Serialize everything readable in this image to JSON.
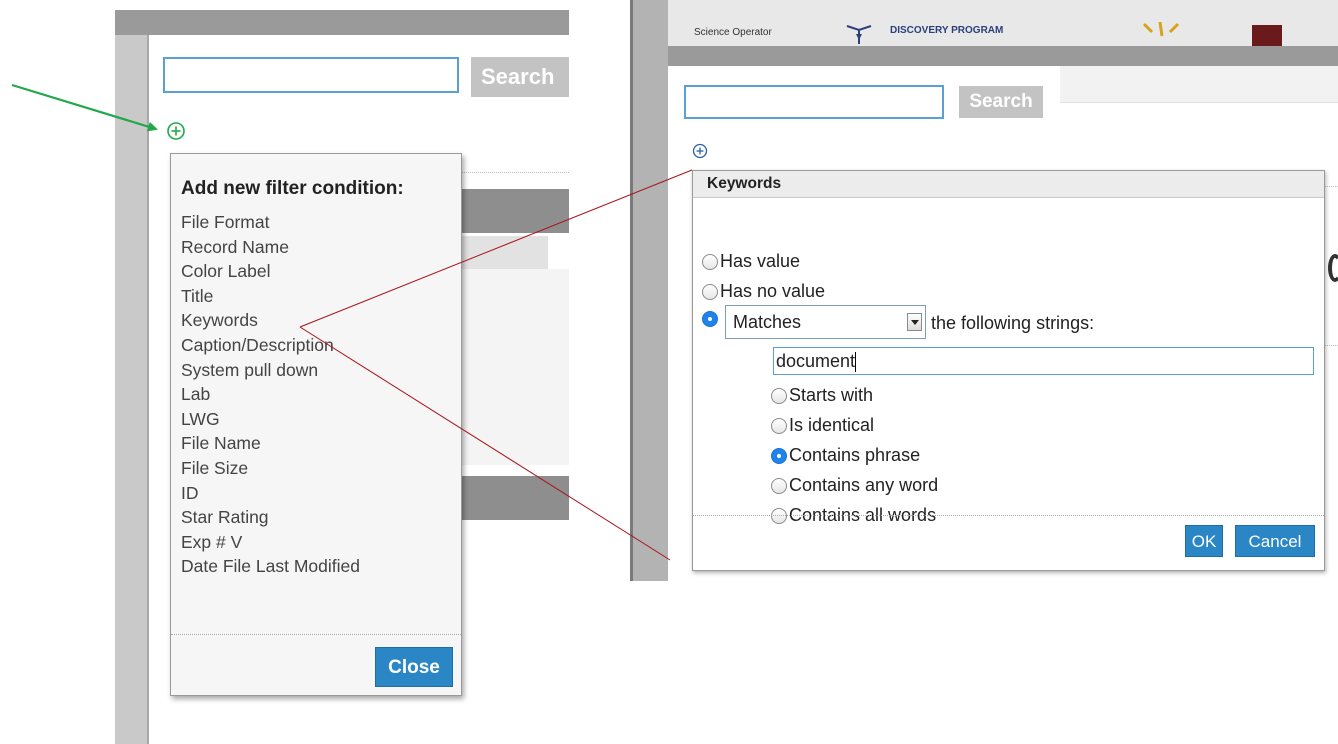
{
  "left_panel": {
    "search_button": "Search",
    "add_filter_icon": "plus-circle-icon",
    "filter_menu": {
      "title": "Add new filter condition:",
      "items": [
        "File Format",
        "Record Name",
        "Color Label",
        "Title",
        "Keywords",
        "Caption/Description",
        "System pull down",
        "Lab",
        "LWG",
        "File Name",
        "File Size",
        "ID",
        "Star Rating",
        "Exp # V",
        "Date File Last Modified"
      ],
      "close_label": "Close"
    }
  },
  "right_panel": {
    "header": {
      "science_operator": "Science Operator",
      "discovery_program": "DISCOVERY PROGRAM"
    },
    "search_button": "Search",
    "add_filter_icon": "plus-circle-icon",
    "keywords_dialog": {
      "title": "Keywords",
      "options": {
        "has_value": "Has value",
        "has_no_value": "Has no value"
      },
      "match_select": "Matches",
      "following_strings": "the following strings:",
      "string_value": "document",
      "match_modes": [
        {
          "label": "Starts with",
          "checked": false
        },
        {
          "label": "Is identical",
          "checked": false
        },
        {
          "label": "Contains phrase",
          "checked": true
        },
        {
          "label": "Contains any word",
          "checked": false
        },
        {
          "label": "Contains all words",
          "checked": false
        }
      ],
      "ok_label": "OK",
      "cancel_label": "Cancel"
    }
  },
  "colors": {
    "accent_blue": "#2b86c5",
    "annotation_green": "#22a84a",
    "annotation_red": "#a8141c"
  }
}
